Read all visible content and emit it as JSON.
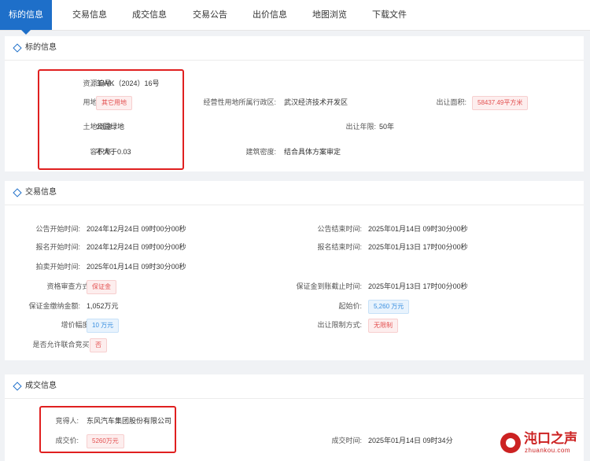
{
  "tabs": [
    {
      "label": "标的信息",
      "active": true
    },
    {
      "label": "交易信息",
      "active": false
    },
    {
      "label": "成交信息",
      "active": false
    },
    {
      "label": "交易公告",
      "active": false
    },
    {
      "label": "出价信息",
      "active": false
    },
    {
      "label": "地图浏览",
      "active": false
    },
    {
      "label": "下载文件",
      "active": false
    }
  ],
  "subject": {
    "title": "标的信息",
    "resource_no": {
      "label": "资源编号:",
      "value": "工WK（2024）16号"
    },
    "land_type": {
      "label": "用地类型:",
      "value": "其它用地"
    },
    "district": {
      "label": "经营性用地所属行政区:",
      "value": "武汉经济技术开发区"
    },
    "area": {
      "label": "出让面积:",
      "value": "58437.49平方米"
    },
    "land_use": {
      "label": "土地用途:",
      "value": "公园绿地"
    },
    "term": {
      "label": "出让年限:",
      "value": "50年"
    },
    "far": {
      "label": "容积率:",
      "value": "不大于0.03"
    },
    "density": {
      "label": "建筑密度:",
      "value": "结合具体方案审定"
    }
  },
  "trade": {
    "title": "交易信息",
    "notice_start": {
      "label": "公告开始时间:",
      "value": "2024年12月24日 09时00分00秒"
    },
    "notice_end": {
      "label": "公告结束时间:",
      "value": "2025年01月14日 09时30分00秒"
    },
    "reg_start": {
      "label": "报名开始时间:",
      "value": "2024年12月24日 09时00分00秒"
    },
    "reg_end": {
      "label": "报名结束时间:",
      "value": "2025年01月13日 17时00分00秒"
    },
    "auction_start": {
      "label": "拍卖开始时间:",
      "value": "2025年01月14日 09时30分00秒"
    },
    "qualification": {
      "label": "资格审查方式:",
      "value": "保证金"
    },
    "deposit_deadline": {
      "label": "保证金到账截止时间:",
      "value": "2025年01月13日 17时00分00秒"
    },
    "deposit_amount": {
      "label": "保证金缴纳金额:",
      "value": "1,052万元"
    },
    "start_price": {
      "label": "起始价:",
      "value": "5,260 万元"
    },
    "increment": {
      "label": "增价幅度:",
      "value": "10 万元"
    },
    "restriction": {
      "label": "出让限制方式:",
      "value": "无限制"
    },
    "joint_bid": {
      "label": "是否允许联合竞买:",
      "value": "否"
    }
  },
  "deal": {
    "title": "成交信息",
    "winner": {
      "label": "竞得人:",
      "value": "东风汽车集团股份有限公司"
    },
    "price": {
      "label": "成交价:",
      "value": "5260万元"
    },
    "time": {
      "label": "成交时间:",
      "value": "2025年01月14日 09时34分"
    }
  },
  "watermark": {
    "brand": "沌口之声",
    "domain": "zhuankou.com"
  },
  "colors": {
    "accent": "#1e6fc9",
    "tag_red": "#e35050",
    "tag_blue": "#3a8fe0",
    "highlight_box": "#e02020"
  }
}
